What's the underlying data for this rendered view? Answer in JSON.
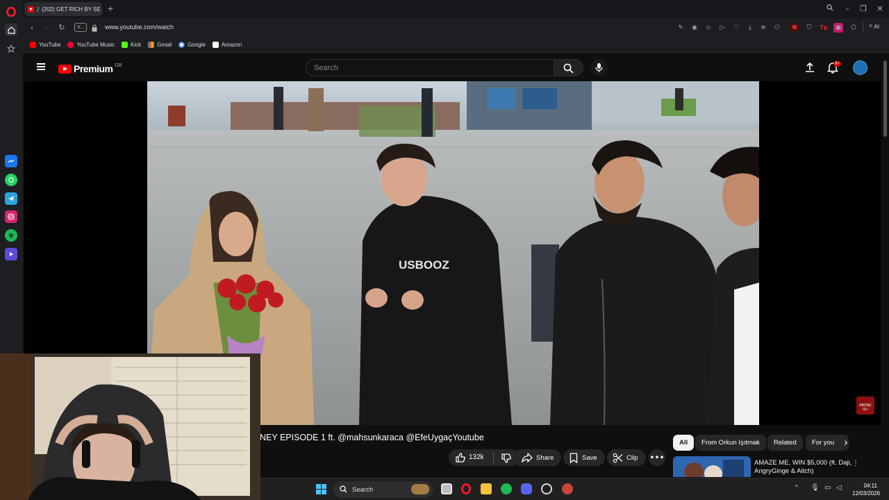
{
  "browser": {
    "tab_title": "(202) GET RICH BY SE",
    "url": "www.youtube.com/watch",
    "url_badge": "V...",
    "bookmarks": [
      "YouTube",
      "YouTube Music",
      "Kick",
      "Gmail",
      "Google",
      "Amazon"
    ],
    "toolbar_ai_label": "AI"
  },
  "youtube": {
    "logo_text": "Premium",
    "logo_sup": "GB",
    "search_placeholder": "Search",
    "notification_count": "9+",
    "video_title": "NEY EPISODE 1 ft. @mahsunkaraca @EfeUygaçYoutube",
    "hoodie_text": "USBOOZ",
    "subscribe_badge_text": "ABONE OL!",
    "actions": {
      "like_count": "132k",
      "share_label": "Share",
      "save_label": "Save",
      "clip_label": "Clip"
    },
    "chips": [
      "All",
      "From Orkun Işıtmak",
      "Related",
      "For you"
    ],
    "recommendation": {
      "title": "AMAZE ME, WIN $5,000 (ft. Daji, AngryGinge & Aitch)"
    }
  },
  "taskbar": {
    "search_label": "Search",
    "time": "04:11",
    "date": "12/03/2026"
  },
  "colors": {
    "yt_red": "#ff0000",
    "background": "#0f0f0f",
    "chip_active": "#f1f1f1"
  }
}
